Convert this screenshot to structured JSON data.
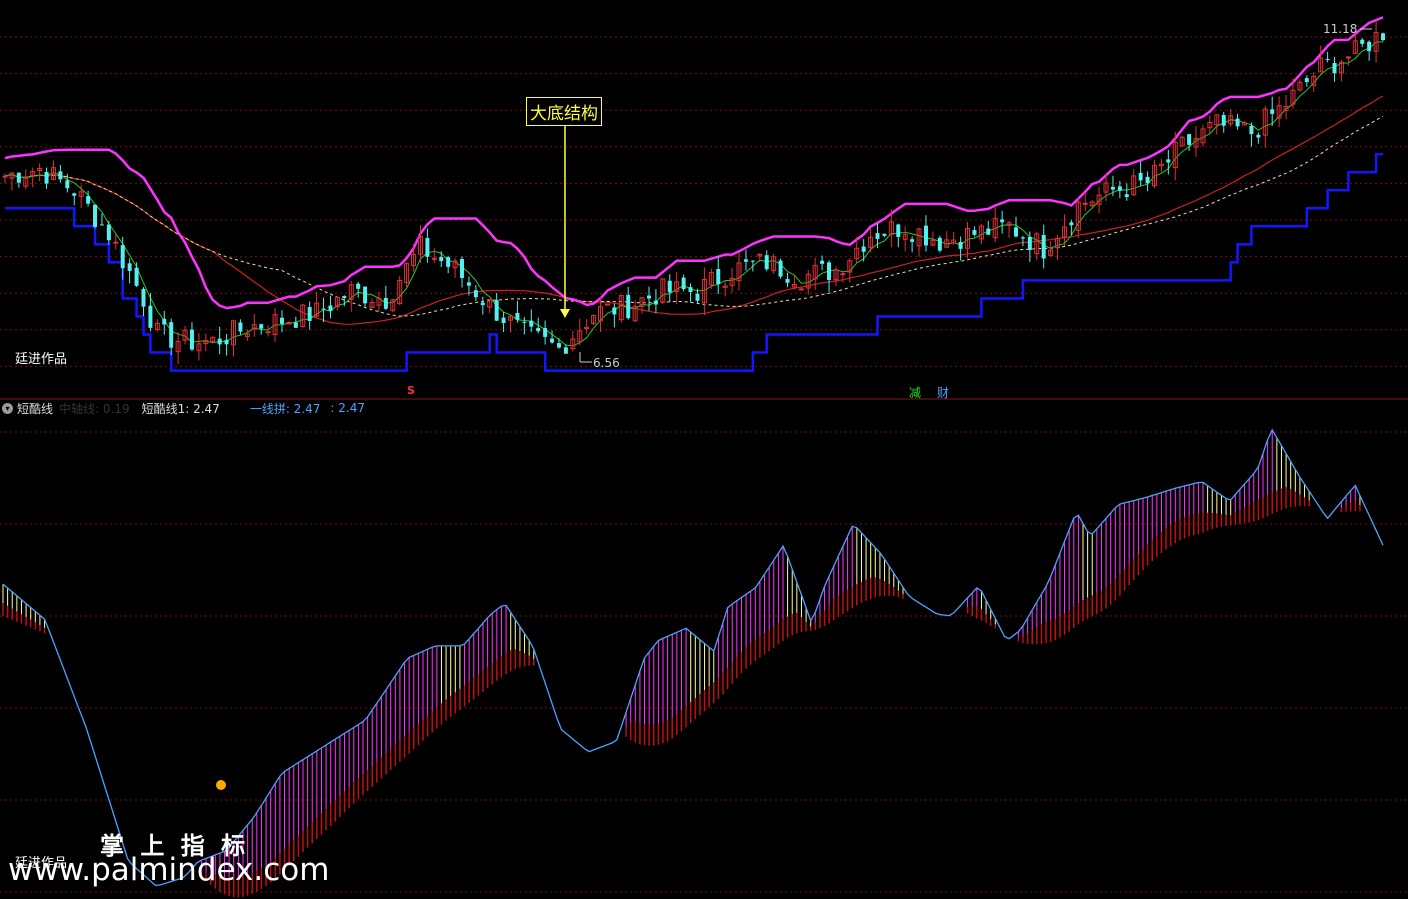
{
  "upper_panel": {
    "author_label": "廷进作品",
    "annotation": "大底结构",
    "low_label": "6.56",
    "high_label": "11.18",
    "signal_s": "S",
    "signal_jian": "减",
    "signal_cai": "财"
  },
  "lower_panel": {
    "indicator_name": "短酷线",
    "legend": [
      {
        "text": "中轴线: 0.19",
        "color": "#222222"
      },
      {
        "text": "短酷线1: 2.47",
        "color": "#dddddd"
      },
      {
        "text": "一线拼: 2.47",
        "color": "#4aa3ff"
      },
      {
        "text": ": 2.47",
        "color": "#4aa3ff"
      }
    ],
    "author_label": "廷进作品"
  },
  "watermark": {
    "cn": "掌 上 指 标",
    "url": "www.palmindex.com"
  },
  "colors": {
    "background": "#000000",
    "grid": "#7a1010",
    "up_candle": "#e0303a",
    "down_candle": "#54f0f0",
    "magenta": "#ff33ff",
    "blue": "#1515ff",
    "green": "#22cc22",
    "red_ma": "#cc2020",
    "dashed_ma": "#f0e0a0",
    "annotation": "#ffff40",
    "cyan_line": "#4aa3ff",
    "yellow_hist": "#ffff90",
    "red_hist": "#c01010"
  },
  "chart_data": [
    {
      "type": "candlestick",
      "price_anchors": {
        "dates_index": [
          0,
          5,
          10,
          15,
          20,
          22,
          26,
          30,
          35,
          40,
          45,
          50,
          55,
          60,
          65,
          70,
          75,
          80,
          85,
          90,
          95,
          100,
          105,
          110,
          115,
          120,
          125,
          130,
          135,
          140,
          145,
          150,
          155,
          160,
          165,
          170,
          175,
          180,
          185,
          190,
          195,
          199
        ],
        "close": [
          9.2,
          9.3,
          9.0,
          8.4,
          7.5,
          7.0,
          6.9,
          6.9,
          7.1,
          7.2,
          7.3,
          7.6,
          7.5,
          8.2,
          7.9,
          7.4,
          7.0,
          6.8,
          7.3,
          7.4,
          7.6,
          7.6,
          7.9,
          8.0,
          7.8,
          7.9,
          8.4,
          8.5,
          8.3,
          8.4,
          8.5,
          8.2,
          8.8,
          9.0,
          9.1,
          9.6,
          9.9,
          9.8,
          10.2,
          10.7,
          10.9,
          11.2
        ]
      },
      "high": 11.18,
      "low": 6.56,
      "series": [
        {
          "name": "upper_channel",
          "style": "magenta"
        },
        {
          "name": "lower_channel",
          "style": "blue"
        },
        {
          "name": "fast_line",
          "style": "green"
        },
        {
          "name": "ma_red",
          "style": "red_ma"
        },
        {
          "name": "ma_dashed",
          "style": "dashed_ma"
        }
      ],
      "grid": true
    },
    {
      "type": "line+histogram",
      "name": "短酷线",
      "line_anchors": {
        "index": [
          0,
          3,
          6,
          9,
          11,
          13,
          14,
          16,
          18,
          20,
          23,
          26,
          29,
          31,
          33,
          35,
          36,
          38,
          40,
          42,
          44,
          46,
          47,
          49,
          51,
          52,
          54,
          56,
          58,
          59,
          61,
          63,
          65,
          67,
          68,
          70,
          72,
          73,
          75,
          77,
          78,
          80,
          82,
          84,
          86,
          88,
          90,
          91,
          93,
          95,
          97,
          99
        ],
        "value": [
          0.46,
          0.26,
          -0.36,
          -1.11,
          -1.25,
          -1.2,
          -1.11,
          -1.05,
          -0.86,
          -0.61,
          -0.46,
          -0.31,
          0.04,
          0.11,
          0.11,
          0.29,
          0.35,
          0.11,
          -0.36,
          -0.49,
          -0.43,
          0.04,
          0.14,
          0.21,
          0.08,
          0.33,
          0.44,
          0.68,
          0.24,
          0.46,
          0.8,
          0.63,
          0.39,
          0.29,
          0.28,
          0.45,
          0.14,
          0.2,
          0.47,
          0.87,
          0.73,
          0.91,
          0.95,
          1.0,
          1.04,
          0.93,
          1.11,
          1.34,
          1.07,
          0.83,
          1.02,
          0.68
        ]
      },
      "histogram": {
        "colors": [
          "#ff33ff",
          "#ffff90",
          "#c01010"
        ]
      },
      "grid": true
    }
  ]
}
